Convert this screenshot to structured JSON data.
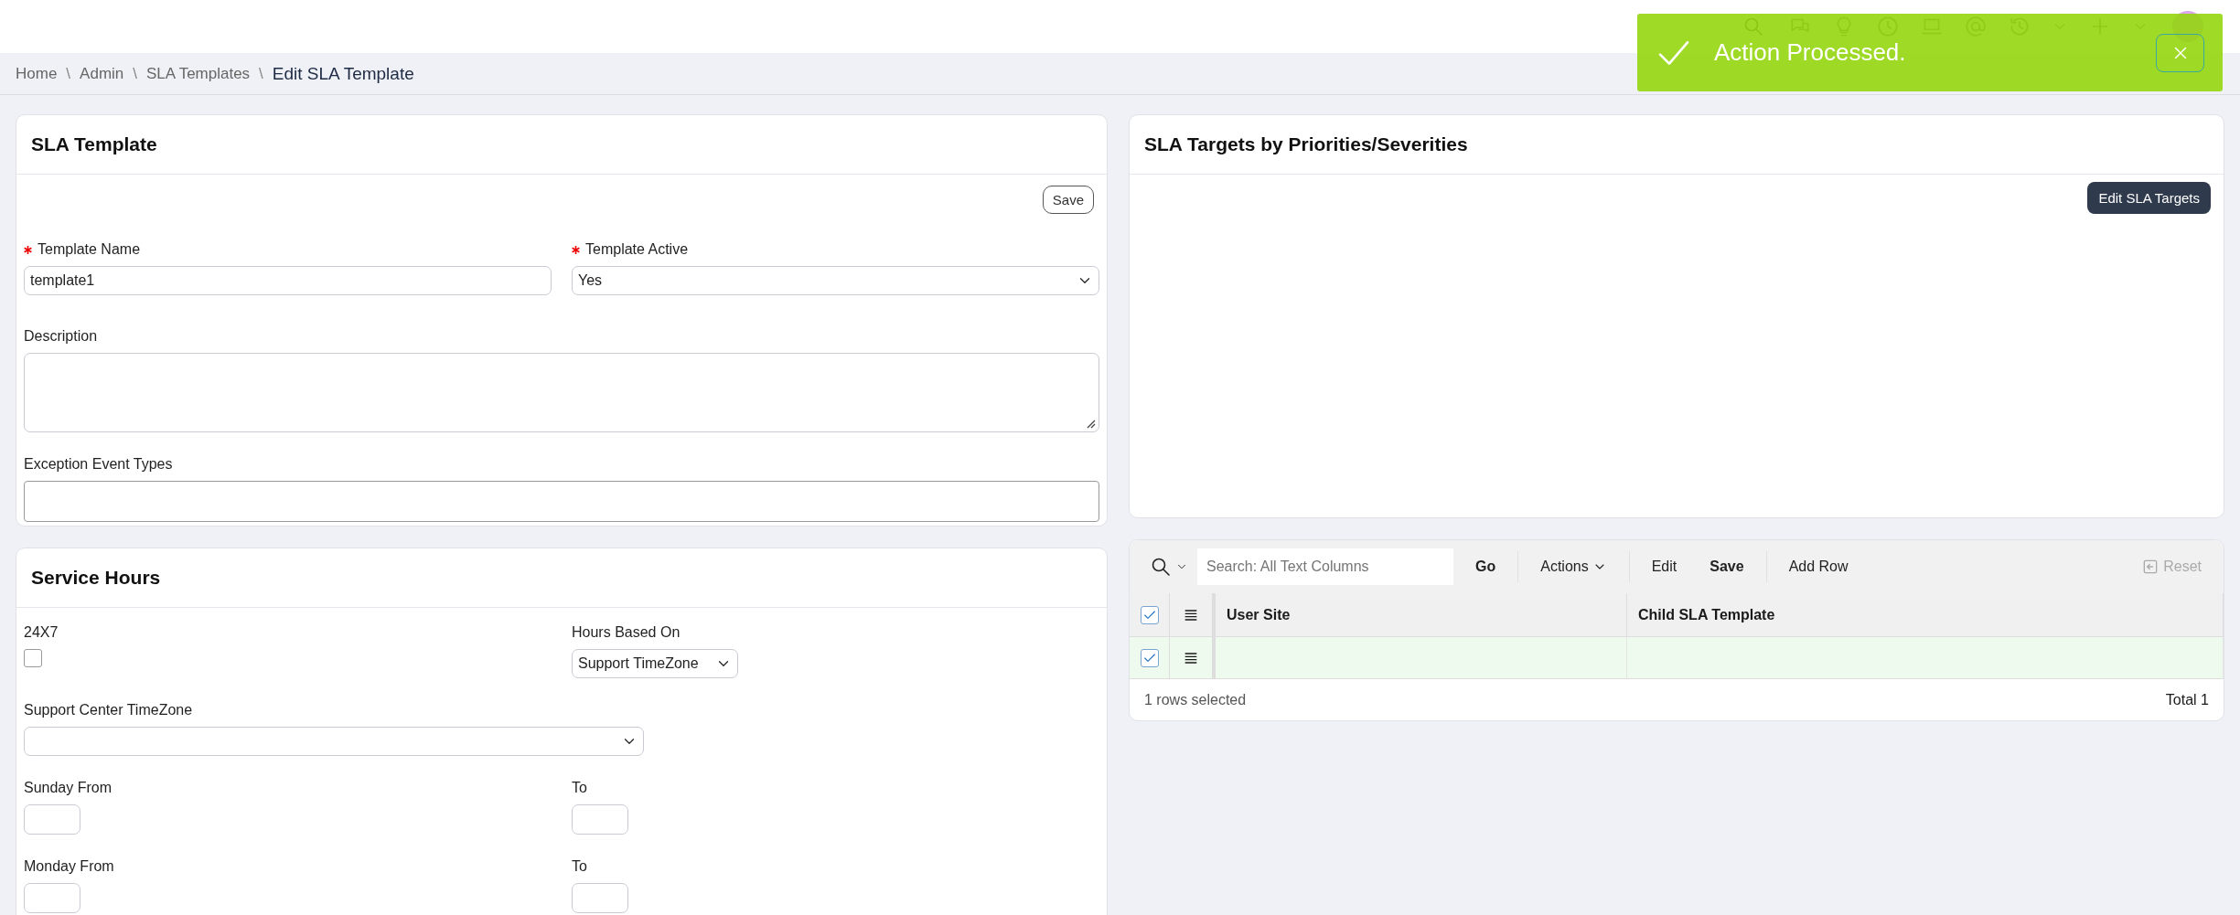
{
  "toast": {
    "message": "Action Processed."
  },
  "breadcrumb": [
    {
      "label": "Home",
      "current": false
    },
    {
      "separator": "\\",
      "label": "Admin",
      "current": false
    },
    {
      "separator": "\\",
      "label": "SLA Templates",
      "current": false
    },
    {
      "separator": "\\",
      "label": "Edit SLA Template",
      "current": true
    }
  ],
  "sla_template": {
    "title": "SLA Template",
    "save_button": "Save",
    "rows": [
      [
        {
          "kind": "text",
          "label": "Template Name",
          "required": true,
          "value": "template1"
        },
        {
          "kind": "select",
          "label": "Template Active",
          "required": true,
          "value": "Yes"
        }
      ],
      [
        {
          "kind": "textarea",
          "label": "Description",
          "required": false
        }
      ],
      [
        {
          "kind": "tags",
          "label": "Exception Event Types",
          "required": false
        }
      ]
    ]
  },
  "service_hours": {
    "title": "Service Hours",
    "rows": [
      [
        {
          "kind": "checkbox",
          "label": "24X7",
          "checked": false
        },
        {
          "kind": "small_select",
          "label": "Hours Based On",
          "value": "Support TimeZone"
        }
      ],
      [
        {
          "kind": "wide_select",
          "label": "Support Center TimeZone"
        }
      ],
      [
        {
          "kind": "time",
          "label": "Sunday From"
        },
        {
          "kind": "time",
          "label": "To"
        }
      ],
      [
        {
          "kind": "time",
          "label": "Monday From"
        },
        {
          "kind": "time",
          "label": "To"
        }
      ]
    ]
  },
  "sla_targets": {
    "title": "SLA Targets by Priorities/Severities",
    "button": "Edit SLA Targets"
  },
  "grid": {
    "search_placeholder": "Search: All Text Columns",
    "go": "Go",
    "actions": "Actions",
    "edit": "Edit",
    "save": "Save",
    "add_row": "Add Row",
    "reset": "Reset",
    "all_selected": true,
    "columns": [
      "User Site",
      "Child SLA Template"
    ],
    "rows": [
      {
        "selected": true
      }
    ],
    "selection_count": "1 rows selected",
    "total": "Total 1"
  }
}
